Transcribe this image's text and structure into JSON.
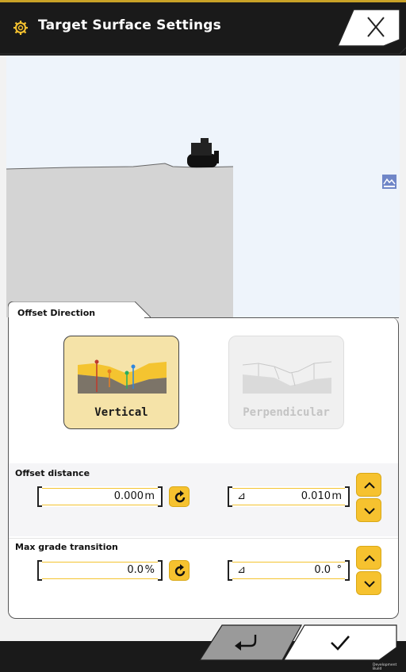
{
  "header": {
    "title": "Target Surface Settings",
    "icon": "gear-icon",
    "close_icon": "close-icon"
  },
  "scene": {
    "machine": "dozer-icon",
    "side_icon": "terrain-view-icon"
  },
  "panel": {
    "tab_label": "Offset Direction",
    "options": [
      {
        "label": "Vertical",
        "selected": true
      },
      {
        "label": "Perpendicular",
        "selected": false
      }
    ]
  },
  "offset_distance": {
    "title": "Offset distance",
    "value": "0.000",
    "unit": "m",
    "slope_symbol": "⊿",
    "slope_value": "0.010",
    "slope_unit": "m"
  },
  "max_grade": {
    "title": "Max grade transition",
    "value": "0.0",
    "unit": "%",
    "slope_symbol": "⊿",
    "slope_value": "0.0",
    "slope_unit": "°"
  },
  "footer": {
    "back_icon": "return-icon",
    "confirm_icon": "check-icon",
    "build_label": "Development Build"
  },
  "colors": {
    "accent": "#f6c22f",
    "header_bg": "#1a1a1a",
    "selected_bg": "#f5e3a8"
  }
}
